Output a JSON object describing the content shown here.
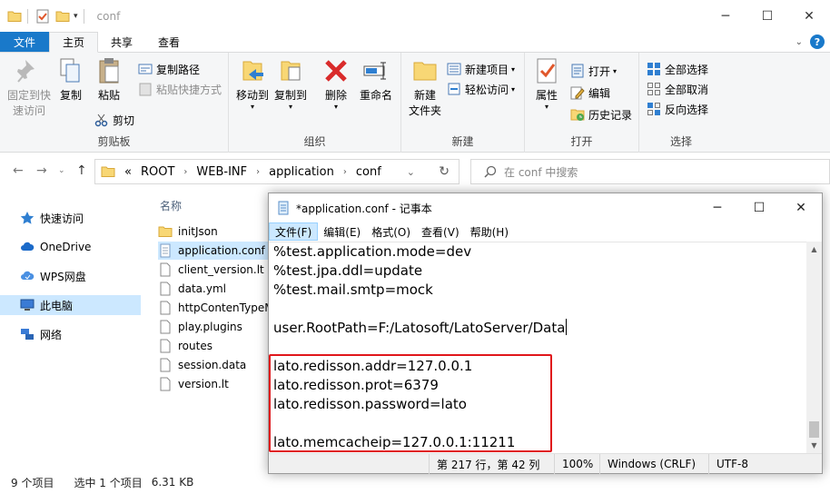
{
  "explorer": {
    "title": "conf",
    "tabs": {
      "file": "文件",
      "home": "主页",
      "share": "共享",
      "view": "查看"
    },
    "ribbon": {
      "pin": "固定到快速访问",
      "pin_l1": "固定到快",
      "pin_l2": "速访问",
      "copy": "复制",
      "paste": "粘贴",
      "copy_path": "复制路径",
      "paste_shortcut": "粘贴快捷方式",
      "cut": "剪切",
      "group_clipboard": "剪贴板",
      "move_to": "移动到",
      "copy_to": "复制到",
      "delete": "删除",
      "rename": "重命名",
      "group_organize": "组织",
      "new_folder_l1": "新建",
      "new_folder_l2": "文件夹",
      "new_item": "新建项目",
      "easy_access": "轻松访问",
      "group_new": "新建",
      "properties": "属性",
      "open": "打开",
      "edit": "编辑",
      "history": "历史记录",
      "group_open": "打开",
      "select_all": "全部选择",
      "select_none": "全部取消",
      "invert_selection": "反向选择",
      "group_select": "选择"
    },
    "address": {
      "overflow": "«",
      "crumbs": [
        "ROOT",
        "WEB-INF",
        "application",
        "conf"
      ]
    },
    "search_placeholder": "在 conf 中搜索",
    "nav": [
      "快速访问",
      "OneDrive",
      "WPS网盘",
      "此电脑",
      "网络"
    ],
    "column_name": "名称",
    "files": [
      "initJson",
      "application.conf",
      "client_version.lt",
      "data.yml",
      "httpContenTypeM",
      "play.plugins",
      "routes",
      "session.data",
      "version.lt"
    ],
    "status": {
      "count": "9 个项目",
      "selected": "选中 1 个项目",
      "size": "6.31 KB"
    }
  },
  "notepad": {
    "title": "*application.conf - 记事本",
    "menu": [
      "文件(F)",
      "编辑(E)",
      "格式(O)",
      "查看(V)",
      "帮助(H)"
    ],
    "lines": [
      "%test.application.mode=dev",
      "%test.jpa.ddl=update",
      "%test.mail.smtp=mock",
      "",
      "user.RootPath=F:/Latosoft/LatoServer/Data",
      "",
      "lato.redisson.addr=127.0.0.1",
      "lato.redisson.prot=6379",
      "lato.redisson.password=lato",
      "",
      "lato.memcacheip=127.0.0.1:11211"
    ],
    "status": {
      "position": "第 217 行，第 42 列",
      "zoom": "100%",
      "line_ending": "Windows (CRLF)",
      "encoding": "UTF-8"
    }
  }
}
